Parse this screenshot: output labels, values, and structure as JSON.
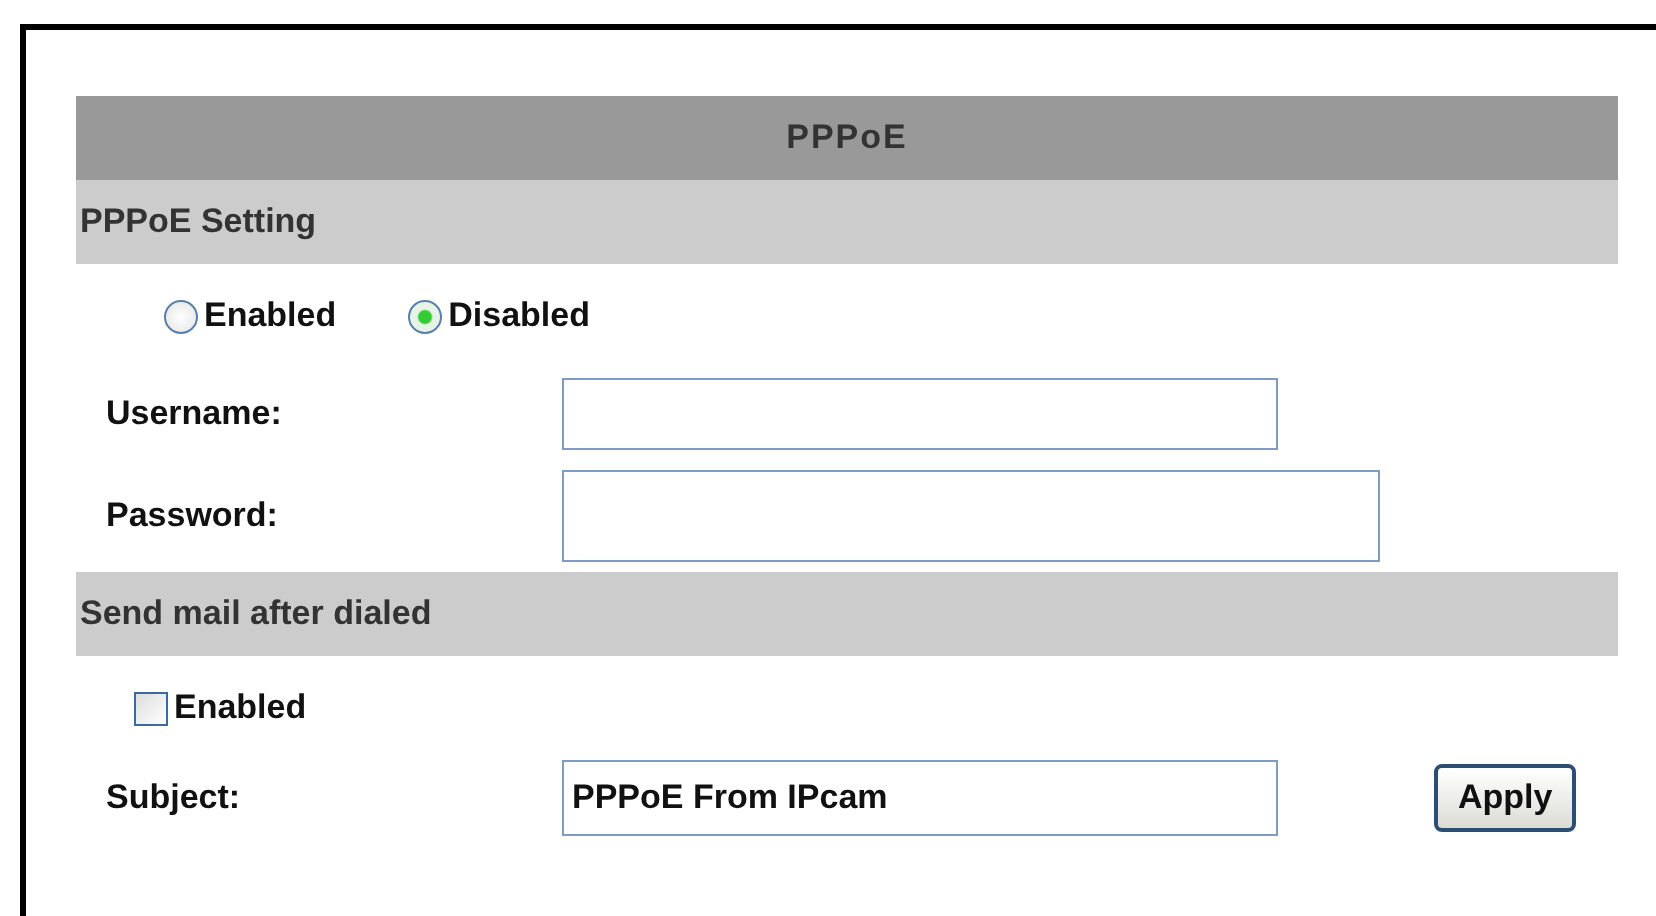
{
  "title": "PPPoE",
  "pppoe_setting": {
    "heading": "PPPoE Setting",
    "options": [
      {
        "label": "Enabled",
        "selected": false
      },
      {
        "label": "Disabled",
        "selected": true
      }
    ],
    "username": {
      "label": "Username:"
    },
    "password": {
      "label": "Password:"
    }
  },
  "send_mail": {
    "heading": "Send mail after dialed",
    "enabled": {
      "label": "Enabled",
      "checked": false
    },
    "subject": {
      "label": "Subject:",
      "value": "PPPoE From IPcam"
    }
  },
  "apply_button": "Apply"
}
